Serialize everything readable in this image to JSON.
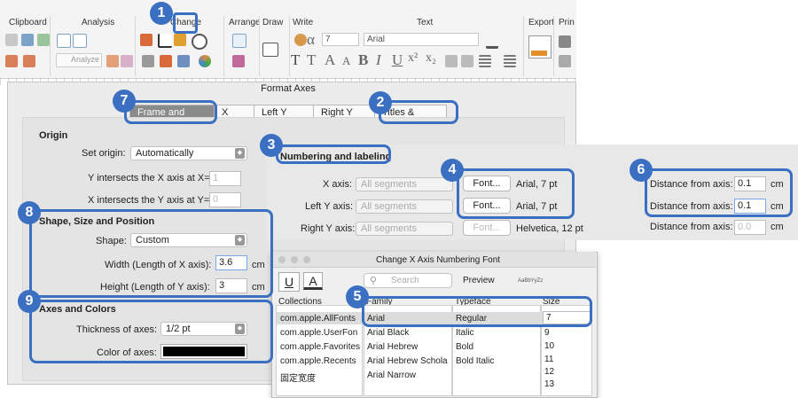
{
  "ribbon": {
    "groups": [
      "Clipboard",
      "Analysis",
      "Change",
      "Arrange",
      "Draw",
      "Write",
      "Text",
      "Export",
      "Prin"
    ],
    "analyze_label": "Analyze",
    "font_size_value": "7",
    "font_name_value": "Arial",
    "write_glyphs": [
      "α",
      "T"
    ],
    "text_glyphs": [
      "T",
      "A",
      "A",
      "B",
      "I",
      "U",
      "x²",
      "x₂"
    ]
  },
  "dialog": {
    "title": "Format Axes",
    "tabs": [
      "Frame and Origin",
      "X Axis",
      "Left Y Axis",
      "Right Y Axis",
      "Titles & Fonts"
    ],
    "origin": {
      "heading": "Origin",
      "set_origin_label": "Set origin:",
      "set_origin_value": "Automatically",
      "x_intersect_label": "Y intersects the X axis at X=",
      "x_intersect_value": "1",
      "y_intersect_label": "X intersects the Y axis at Y=",
      "y_intersect_value": "0"
    },
    "shape": {
      "heading": "Shape, Size and Position",
      "shape_label": "Shape:",
      "shape_value": "Custom",
      "width_label": "Width (Length of X axis):",
      "width_value": "3.6",
      "height_label": "Height (Length of Y axis):",
      "height_value": "3",
      "unit": "cm"
    },
    "axes_colors": {
      "heading": "Axes and Colors",
      "thickness_label": "Thickness of axes:",
      "thickness_value": "1/2 pt",
      "color_label": "Color of axes:",
      "color_value": "#000000"
    },
    "numbering": {
      "heading": "Numbering and labeling",
      "rows": [
        {
          "label": "X axis:",
          "select": "All segments",
          "font_button": "Font...",
          "font_value": "Arial, 7 pt",
          "distance_label": "Distance from axis:",
          "distance_value": "0.1",
          "unit": "cm"
        },
        {
          "label": "Left Y axis:",
          "select": "All segments",
          "font_button": "Font...",
          "font_value": "Arial, 7 pt",
          "distance_label": "Distance from axis:",
          "distance_value": "0.1",
          "unit": "cm"
        },
        {
          "label": "Right Y axis:",
          "select": "All segments",
          "font_button": "Font...",
          "font_value": "Helvetica, 12 pt",
          "distance_label": "Distance from axis:",
          "distance_value": "0.0",
          "unit": "cm"
        }
      ]
    }
  },
  "font_window": {
    "title": "Change X Axis Numbering Font",
    "search_placeholder": "Search",
    "preview_label": "Preview",
    "preview_sample": "AaBbYyZz",
    "columns": {
      "collections": "Collections",
      "family": "Family",
      "typeface": "Typeface",
      "size": "Size"
    },
    "collections": [
      "com.apple.AllFonts",
      "com.apple.UserFon",
      "com.apple.Favorites",
      "com.apple.Recents",
      "固定宽度"
    ],
    "families": [
      "Arial",
      "Arial Black",
      "Arial Hebrew",
      "Arial Hebrew Schola",
      "Arial Narrow"
    ],
    "typefaces": [
      "Regular",
      "Italic",
      "Bold",
      "Bold Italic"
    ],
    "size_value": "7",
    "sizes": [
      "9",
      "10",
      "11",
      "12",
      "13"
    ]
  },
  "callouts": [
    "1",
    "2",
    "3",
    "4",
    "5",
    "6",
    "7",
    "8",
    "9"
  ],
  "colors": {
    "callout": "#3a6fc1",
    "tab_selected": "#8a8a8a",
    "selection": "#dcdcdc"
  }
}
